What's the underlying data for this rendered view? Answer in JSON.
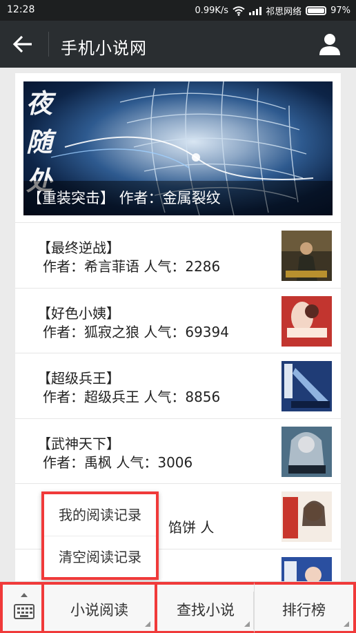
{
  "status_bar": {
    "time": "12:28",
    "speed": "0.99K/s",
    "carrier": "祁思网络",
    "battery": "97%"
  },
  "header": {
    "title": "手机小说网",
    "back_icon": "arrow-left-icon",
    "user_icon": "user-icon"
  },
  "banner": {
    "caption": "【重装突击】 作者：金属裂纹",
    "artwork_text": "夜\n随\n处"
  },
  "books": [
    {
      "name": "【最终逆战】",
      "meta": "作者：希言菲语  人气：2286"
    },
    {
      "name": "【好色小姨】",
      "meta": "作者：狐寂之狼  人气：69394"
    },
    {
      "name": "【超级兵王】",
      "meta": "作者：超级兵王  人气：8856"
    },
    {
      "name": "【武神天下】",
      "meta": "作者：禹枫  人气：3006"
    },
    {
      "name": "",
      "meta": "馅饼  人"
    },
    {
      "name": "",
      "meta": ""
    }
  ],
  "popup_menu": {
    "items": [
      "我的阅读记录",
      "清空阅读记录"
    ]
  },
  "bottom_bar": {
    "keyboard_icon": "keyboard-icon",
    "tabs": [
      "小说阅读",
      "查找小说",
      "排行榜"
    ]
  },
  "colors": {
    "status_bar": "#1d1f20",
    "header": "#2a2e31",
    "highlight": "#f03a3a"
  }
}
